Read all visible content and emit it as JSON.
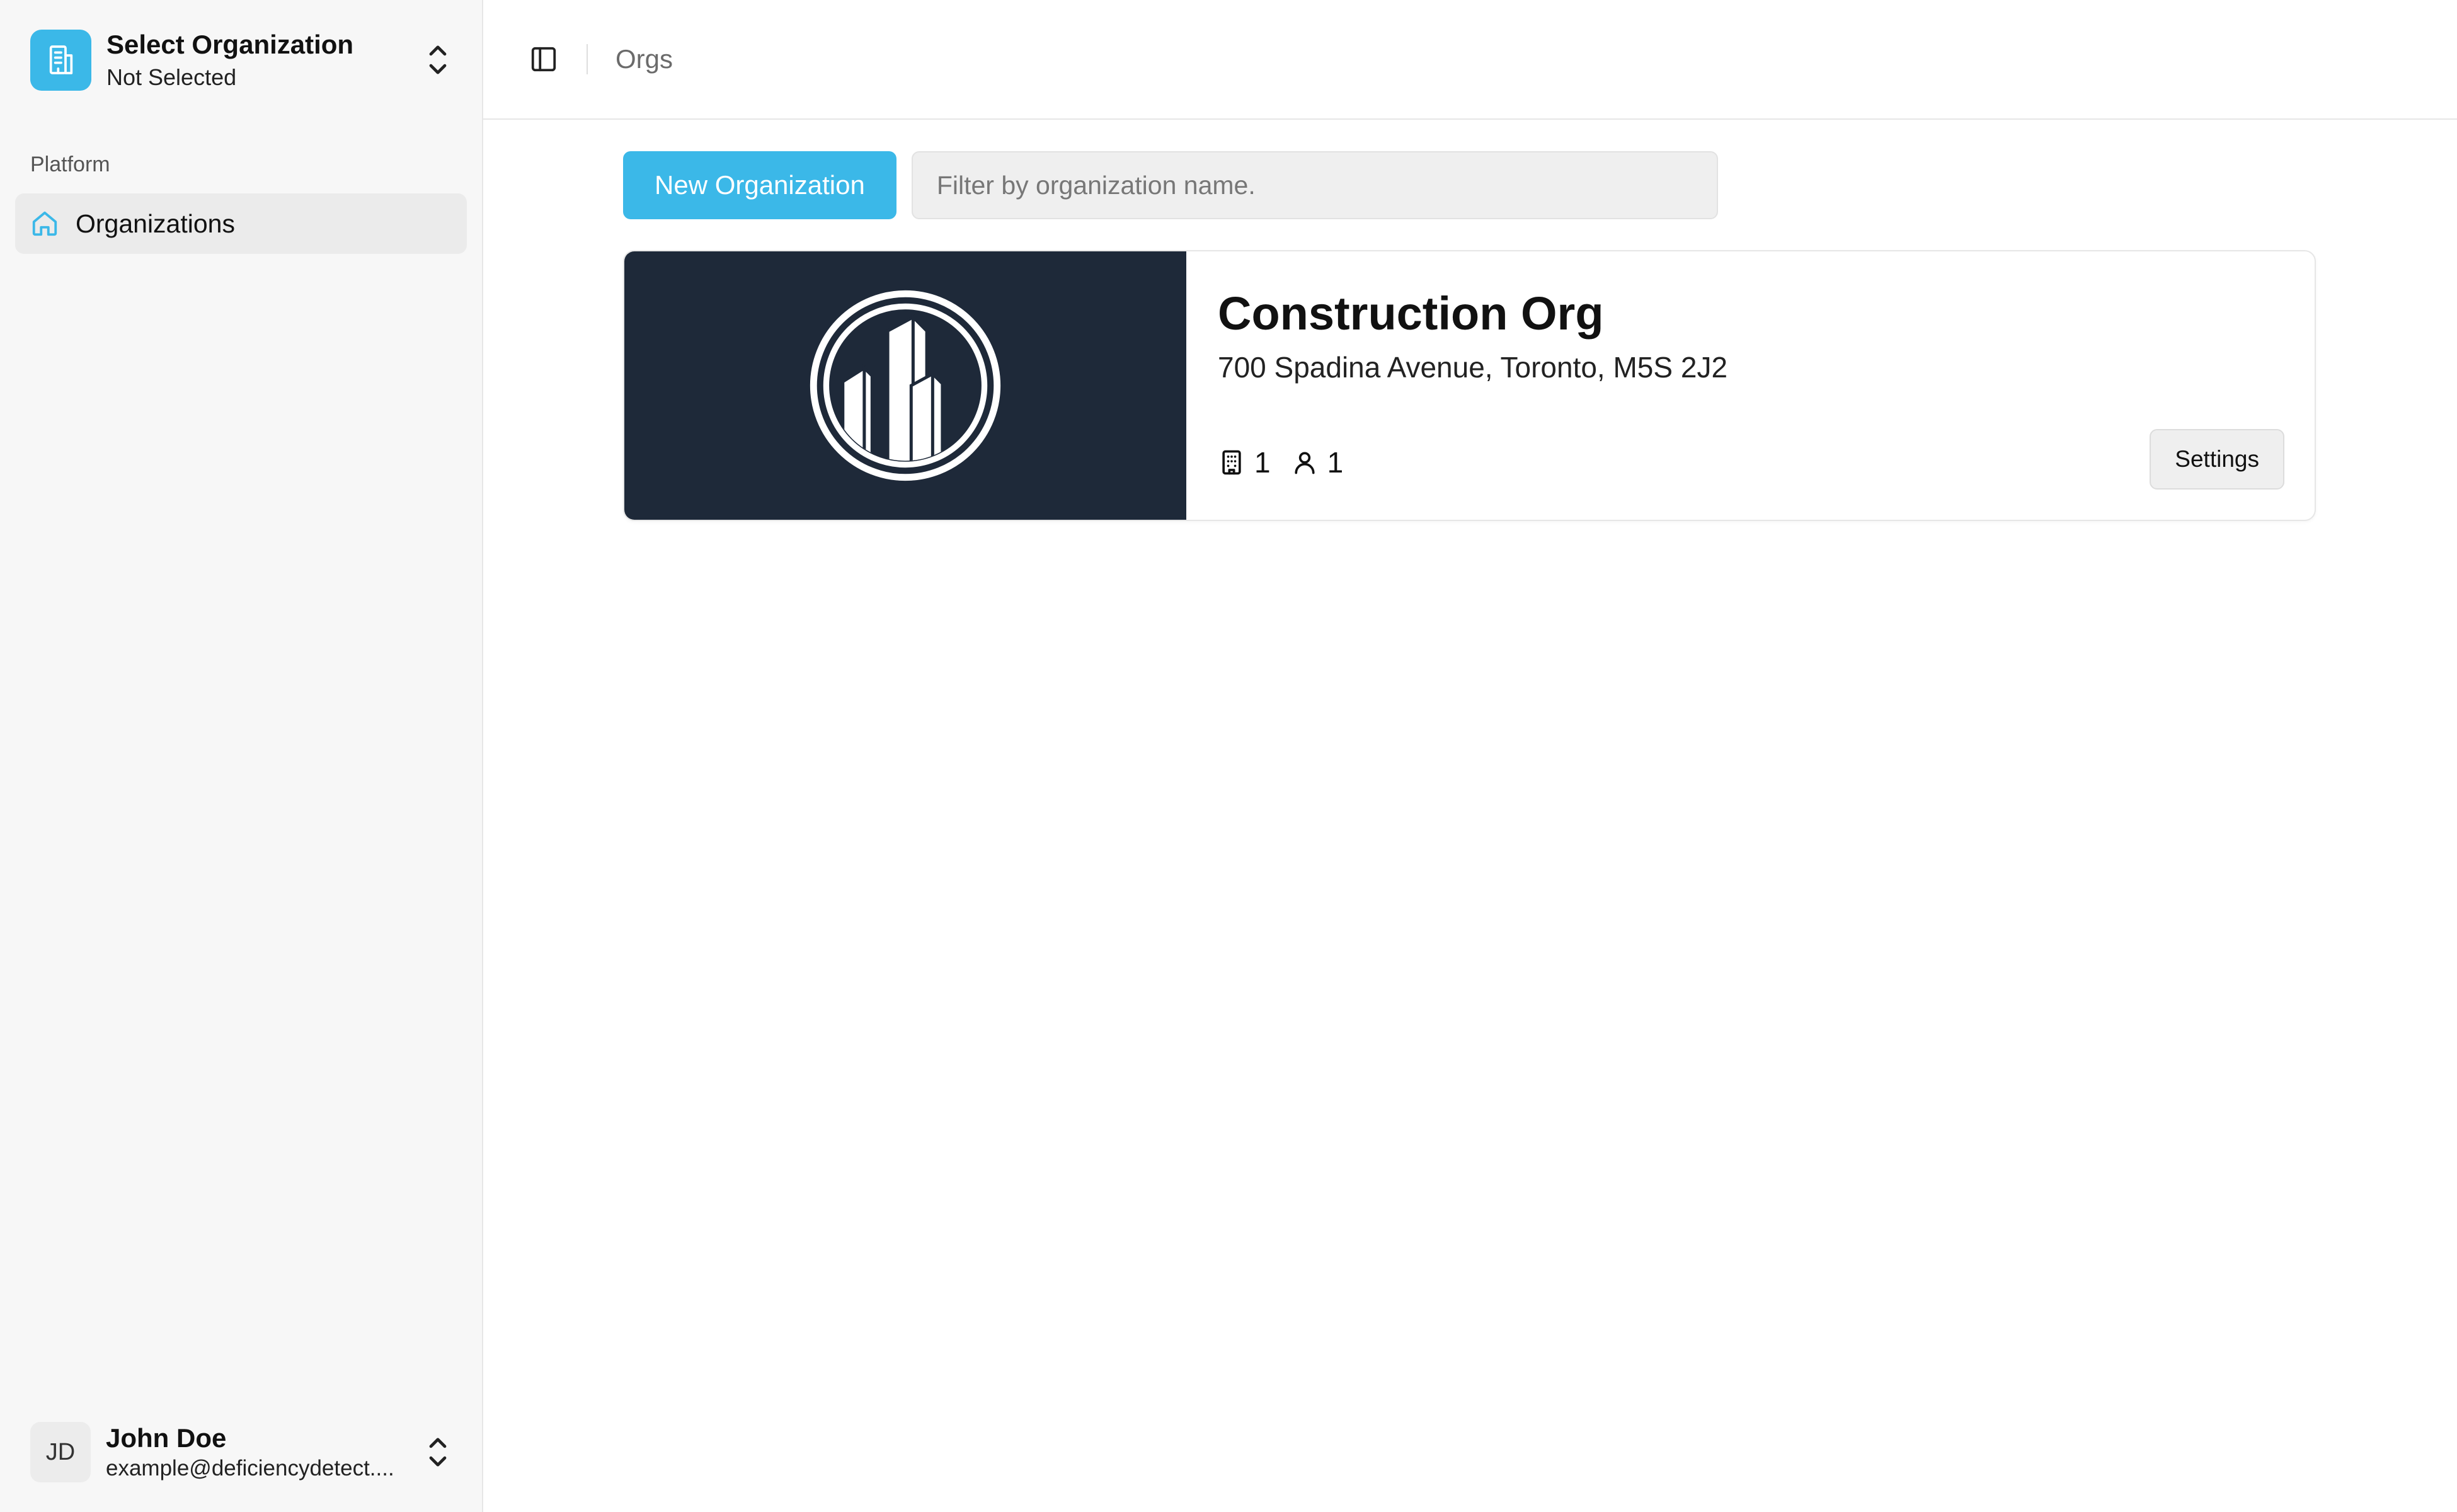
{
  "sidebar": {
    "org_switcher": {
      "title": "Select Organization",
      "subtitle": "Not Selected"
    },
    "section_label": "Platform",
    "items": [
      {
        "label": "Organizations",
        "icon": "home-icon",
        "active": true
      }
    ],
    "user": {
      "initials": "JD",
      "name": "John Doe",
      "email": "example@deficiencydetect...."
    }
  },
  "header": {
    "breadcrumb": "Orgs"
  },
  "toolbar": {
    "new_label": "New Organization",
    "filter_placeholder": "Filter by organization name.",
    "filter_value": ""
  },
  "organizations": [
    {
      "name": "Construction Org",
      "address": "700 Spadina Avenue, Toronto, M5S 2J2",
      "buildings": "1",
      "members": "1",
      "settings_label": "Settings"
    }
  ],
  "colors": {
    "accent": "#3bb8e8",
    "card_image_bg": "#1e2939",
    "sidebar_bg": "#f7f7f7"
  }
}
